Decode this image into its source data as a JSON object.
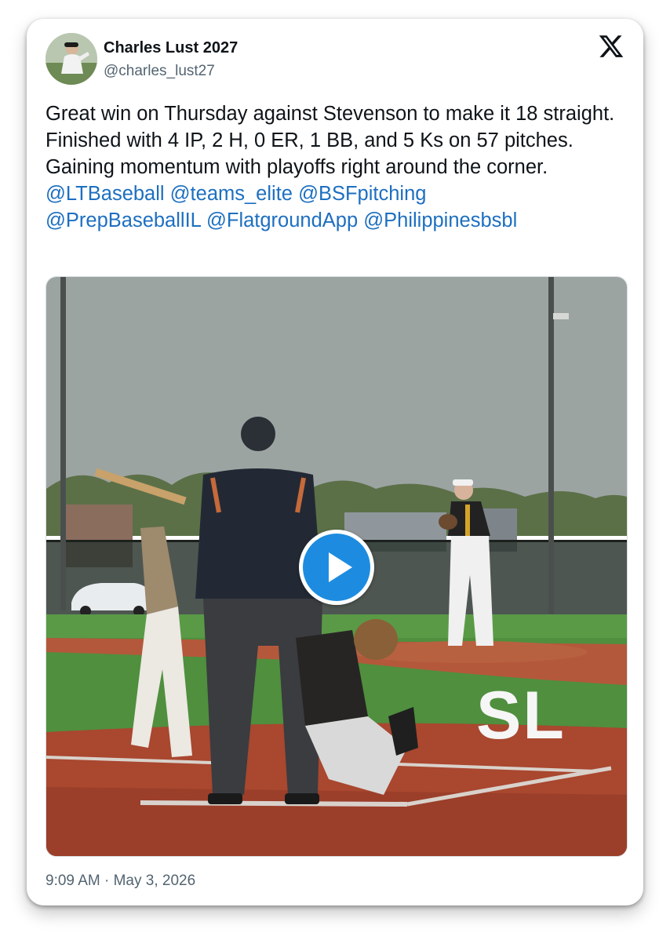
{
  "author": {
    "display_name": "Charles Lust 2027",
    "handle": "@charles_lust27"
  },
  "tweet": {
    "text": "Great win on Thursday against Stevenson to make it 18 straight. Finished with 4 IP, 2 H, 0 ER, 1 BB, and 5 Ks on 57 pitches. Gaining momentum with playoffs right around the corner.",
    "mentions": [
      "@LTBaseball",
      "@teams_elite",
      "@BSFpitching",
      "@PrepBaseballIL",
      "@FlatgroundApp",
      "@Philippinesbsbl"
    ]
  },
  "media": {
    "type": "video",
    "watermark": "SL",
    "play_icon": "play-icon"
  },
  "timestamp": "9:09 AM · May 3, 2026",
  "icons": {
    "brand": "x-logo-icon"
  },
  "colors": {
    "link": "#1d6fc0",
    "play_button": "#1d8ce0",
    "text": "#0f1419",
    "secondary_text": "#536471"
  }
}
